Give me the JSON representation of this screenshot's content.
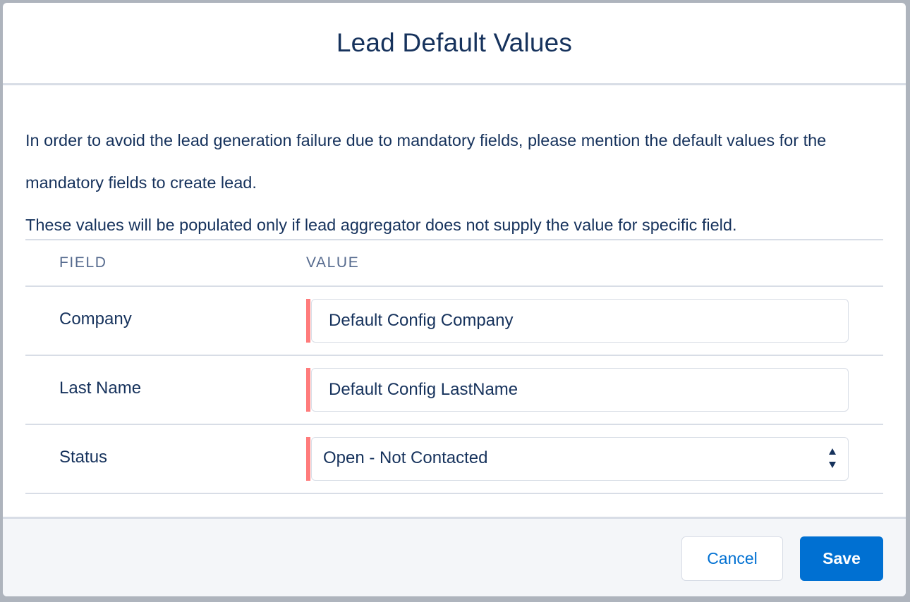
{
  "modal": {
    "title": "Lead Default Values"
  },
  "intro": {
    "paragraph_1": "In order to avoid the lead generation failure due to mandatory fields, please mention the default values for the mandatory fields to create lead.",
    "paragraph_2": "These values will be populated only if lead aggregator does not supply the value for specific field."
  },
  "table": {
    "headers": {
      "field": "FIELD",
      "value": "VALUE"
    },
    "rows": [
      {
        "label": "Company",
        "value": "Default Config Company",
        "required": true
      },
      {
        "label": "Last Name",
        "value": "Default Config LastName",
        "required": true
      },
      {
        "label": "Status",
        "value": "Open - Not Contacted",
        "required": true
      }
    ]
  },
  "footer": {
    "cancel_label": "Cancel",
    "save_label": "Save"
  },
  "colors": {
    "title_text": "#16325c",
    "required_marker": "#ff7b7b",
    "brand_button": "#0070d2",
    "footer_bg": "#f4f6f9",
    "border": "#d8dde6"
  },
  "icons": {
    "select_arrows": "sort-arrows-icon"
  }
}
